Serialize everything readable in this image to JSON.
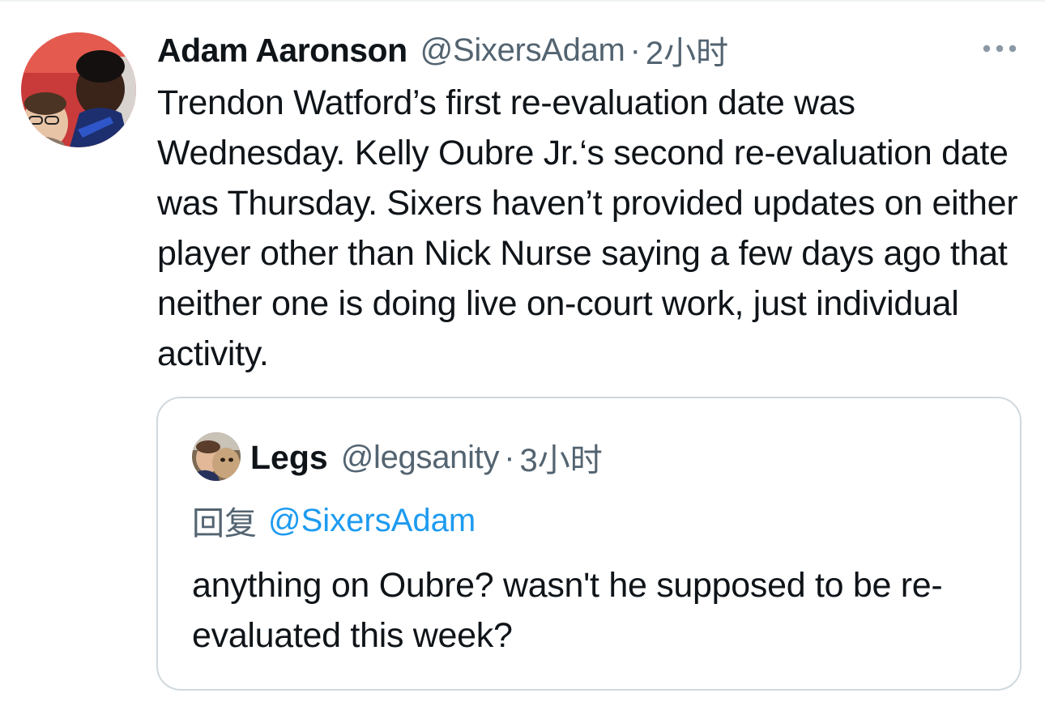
{
  "tweet": {
    "author_name": "Adam Aaronson",
    "handle": "@SixersAdam",
    "separator": "·",
    "time": "2小时",
    "more_icon": "more-horizontal-icon",
    "text": "Trendon Watford’s first re-evaluation date was Wednesday. Kelly Oubre Jr.‘s second re-evaluation date was Thursday. Sixers haven’t provided updates on either player other than Nick Nurse saying a few days ago that neither one is doing live on-court work, just individual activity."
  },
  "quote": {
    "author_name": "Legs",
    "handle": "@legsanity",
    "separator": "·",
    "time": "3小时",
    "reply_prefix": "回复",
    "reply_to": "@SixersAdam",
    "text": "anything on Oubre? wasn't he supposed to be re-evaluated this week?"
  },
  "colors": {
    "text_primary": "#0f1419",
    "text_secondary": "#536471",
    "link": "#1d9bf0",
    "border": "#cfd9de"
  }
}
